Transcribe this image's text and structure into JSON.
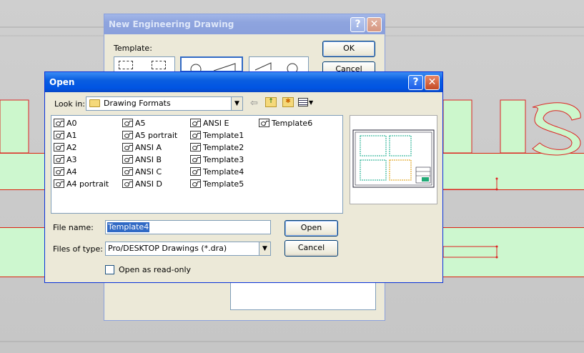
{
  "background": {
    "letters": "NSI    LES"
  },
  "ned": {
    "title": "New Engineering Drawing",
    "template_label": "Template:",
    "ok_label": "OK",
    "cancel_label": "Cancel"
  },
  "open": {
    "title": "Open",
    "look_in_label": "Look in:",
    "look_in_value": "Drawing Formats",
    "files": [
      "A0",
      "A1",
      "A2",
      "A3",
      "A4",
      "A4 portrait",
      "A5",
      "A5 portrait",
      "ANSI A",
      "ANSI B",
      "ANSI C",
      "ANSI D",
      "ANSI E",
      "Template1",
      "Template2",
      "Template3",
      "Template4",
      "Template5",
      "Template6"
    ],
    "file_name_label": "File name:",
    "file_name_value": "Template4",
    "files_of_type_label": "Files of type:",
    "files_of_type_value": "Pro/DESKTOP Drawings (*.dra)",
    "open_button": "Open",
    "cancel_button": "Cancel",
    "read_only_label": "Open as read-only",
    "read_only_checked": false
  }
}
